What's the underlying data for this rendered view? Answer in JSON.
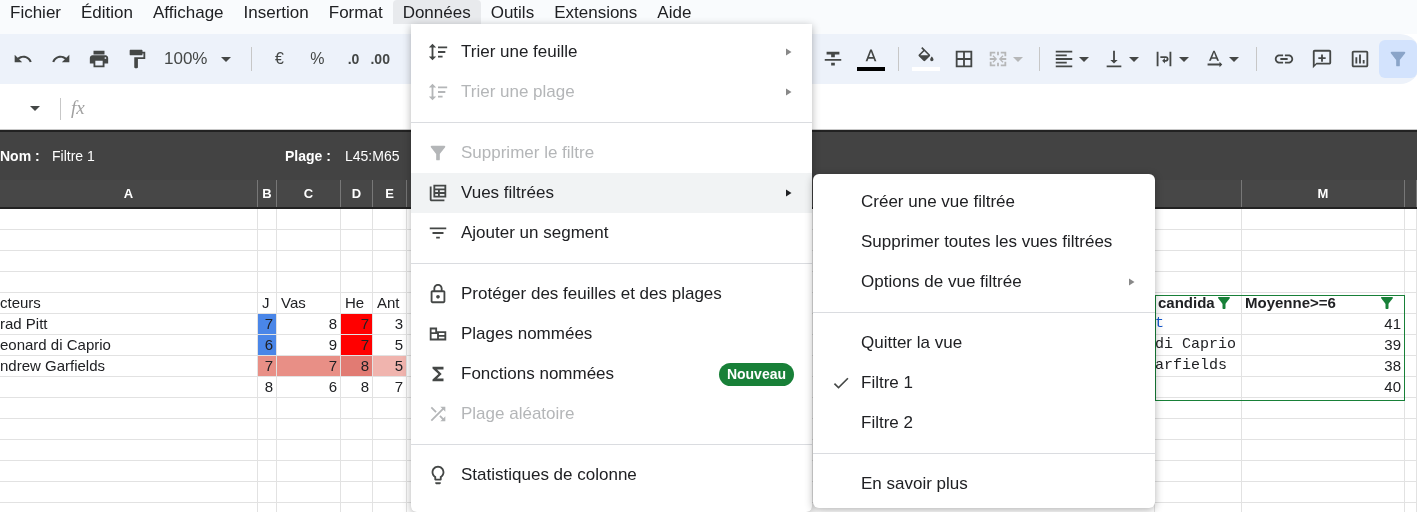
{
  "menubar": [
    {
      "label": "Fichier",
      "selected": false
    },
    {
      "label": "Édition",
      "selected": false
    },
    {
      "label": "Affichage",
      "selected": false
    },
    {
      "label": "Insertion",
      "selected": false
    },
    {
      "label": "Format",
      "selected": false
    },
    {
      "label": "Données",
      "selected": true
    },
    {
      "label": "Outils",
      "selected": false
    },
    {
      "label": "Extensions",
      "selected": false
    },
    {
      "label": "Aide",
      "selected": false
    }
  ],
  "toolbar": {
    "zoom": "100%",
    "currency": "€",
    "percent": "%",
    "decrease_decimals": ".0",
    "increase_decimals": ".00",
    "merge_disabled": true,
    "filter_active": true
  },
  "formula_bar": {
    "fx": "fx"
  },
  "filter_bar": {
    "name_label": "Nom :",
    "name": "Filtre 1",
    "range_label": "Plage :",
    "range": "L45:M65"
  },
  "grid": {
    "columns_left": [
      "A",
      "B",
      "C",
      "D",
      "E"
    ],
    "columns_right": [
      "M"
    ],
    "rows": [
      {
        "left": [
          {
            "text": "cteurs",
            "kind": "text"
          },
          {
            "text": "J",
            "kind": "text"
          },
          {
            "text": "Vas",
            "kind": "text"
          },
          {
            "text": "He",
            "kind": "text"
          },
          {
            "text": "Ant",
            "kind": "text"
          }
        ],
        "right": [
          {
            "text": "candida",
            "kind": "filter_header"
          },
          {
            "text": "Moyenne>=6",
            "kind": "filter_header"
          }
        ]
      },
      {
        "left": [
          {
            "text": "rad Pitt",
            "kind": "text"
          },
          {
            "text": "7",
            "kind": "number",
            "color": "#4a86e8"
          },
          {
            "text": "8",
            "kind": "number"
          },
          {
            "text": "7",
            "kind": "number",
            "color": "#ff0000"
          },
          {
            "text": "3",
            "kind": "number"
          }
        ],
        "right": [
          {
            "text": "t",
            "kind": "link"
          },
          {
            "text": "41",
            "kind": "number"
          }
        ]
      },
      {
        "left": [
          {
            "text": "eonard di Caprio",
            "kind": "text"
          },
          {
            "text": "6",
            "kind": "number",
            "color": "#4a86e8"
          },
          {
            "text": "9",
            "kind": "number"
          },
          {
            "text": "7",
            "kind": "number",
            "color": "#ff0000"
          },
          {
            "text": "5",
            "kind": "number"
          }
        ],
        "right": [
          {
            "text": "di Caprio",
            "kind": "mono"
          },
          {
            "text": "39",
            "kind": "number"
          }
        ]
      },
      {
        "left": [
          {
            "text": "ndrew Garfields",
            "kind": "text"
          },
          {
            "text": "7",
            "kind": "number",
            "color": "#e88f86"
          },
          {
            "text": "7",
            "kind": "number",
            "color": "#e88f86"
          },
          {
            "text": "8",
            "kind": "number",
            "color": "#e17b73"
          },
          {
            "text": "5",
            "kind": "number",
            "color": "#f0b4ae"
          }
        ],
        "right": [
          {
            "text": "arfields",
            "kind": "mono"
          },
          {
            "text": "38",
            "kind": "number"
          }
        ]
      },
      {
        "left": [
          {
            "kind": "empty"
          },
          {
            "text": "8",
            "kind": "number"
          },
          {
            "text": "6",
            "kind": "number"
          },
          {
            "text": "8",
            "kind": "number"
          },
          {
            "text": "7",
            "kind": "number"
          }
        ],
        "right": [
          {
            "kind": "empty"
          },
          {
            "text": "40",
            "kind": "number"
          }
        ]
      }
    ]
  },
  "data_menu": {
    "sections": [
      [
        {
          "label": "Trier une feuille",
          "disabled": false,
          "submenu": true,
          "selected": false
        },
        {
          "label": "Trier une plage",
          "disabled": true,
          "submenu": true,
          "selected": false
        }
      ],
      [
        {
          "label": "Supprimer le filtre",
          "disabled": true,
          "submenu": false,
          "selected": false
        },
        {
          "label": "Vues filtrées",
          "disabled": false,
          "submenu": true,
          "selected": true
        },
        {
          "label": "Ajouter un segment",
          "disabled": false,
          "submenu": false,
          "selected": false
        }
      ],
      [
        {
          "label": "Protéger des feuilles et des plages",
          "disabled": false,
          "submenu": false,
          "selected": false
        },
        {
          "label": "Plages nommées",
          "disabled": false,
          "submenu": false,
          "selected": false
        },
        {
          "label": "Fonctions nommées",
          "disabled": false,
          "submenu": false,
          "selected": false,
          "badge": "Nouveau"
        },
        {
          "label": "Plage aléatoire",
          "disabled": true,
          "submenu": false,
          "selected": false
        }
      ],
      [
        {
          "label": "Statistiques de colonne",
          "disabled": false,
          "submenu": false,
          "selected": false
        }
      ]
    ]
  },
  "filter_views_menu": {
    "sections": [
      [
        {
          "label": "Créer une vue filtrée",
          "checked": false,
          "submenu": false
        },
        {
          "label": "Supprimer toutes les vues filtrées",
          "checked": false,
          "submenu": false
        },
        {
          "label": "Options de vue filtrée",
          "checked": false,
          "submenu": true
        }
      ],
      [
        {
          "label": "Quitter la vue",
          "checked": false,
          "submenu": false
        },
        {
          "label": "Filtre 1",
          "checked": true,
          "submenu": false
        },
        {
          "label": "Filtre 2",
          "checked": false,
          "submenu": false
        }
      ],
      [
        {
          "label": "En savoir plus",
          "checked": false,
          "submenu": false
        }
      ]
    ]
  }
}
